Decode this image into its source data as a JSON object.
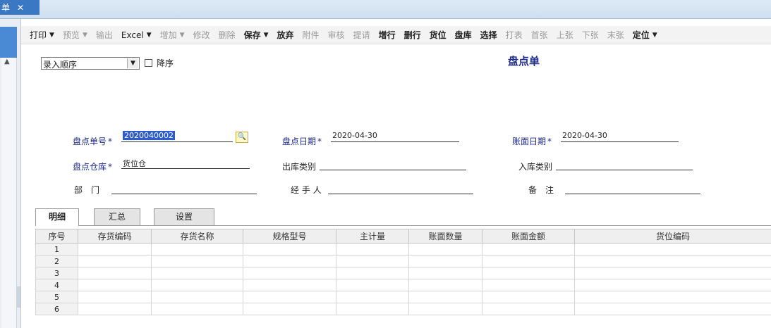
{
  "tab": {
    "title": "单",
    "close": "✕"
  },
  "toolbar": [
    {
      "label": "打印",
      "caret": true,
      "state": "normal"
    },
    {
      "label": "预览",
      "caret": true,
      "state": "disabled"
    },
    {
      "label": "输出",
      "caret": false,
      "state": "disabled"
    },
    {
      "label": "Excel",
      "caret": true,
      "state": "normal"
    },
    {
      "label": "增加",
      "caret": true,
      "state": "disabled"
    },
    {
      "label": "修改",
      "caret": false,
      "state": "disabled"
    },
    {
      "label": "删除",
      "caret": false,
      "state": "disabled"
    },
    {
      "label": "保存",
      "caret": true,
      "state": "bold"
    },
    {
      "label": "放弃",
      "caret": false,
      "state": "bold"
    },
    {
      "label": "附件",
      "caret": false,
      "state": "disabled"
    },
    {
      "label": "审核",
      "caret": false,
      "state": "disabled"
    },
    {
      "label": "提请",
      "caret": false,
      "state": "disabled"
    },
    {
      "label": "增行",
      "caret": false,
      "state": "bold"
    },
    {
      "label": "删行",
      "caret": false,
      "state": "bold"
    },
    {
      "label": "货位",
      "caret": false,
      "state": "bold"
    },
    {
      "label": "盘库",
      "caret": false,
      "state": "bold"
    },
    {
      "label": "选择",
      "caret": false,
      "state": "bold"
    },
    {
      "label": "打表",
      "caret": false,
      "state": "disabled"
    },
    {
      "label": "首张",
      "caret": false,
      "state": "disabled"
    },
    {
      "label": "上张",
      "caret": false,
      "state": "disabled"
    },
    {
      "label": "下张",
      "caret": false,
      "state": "disabled"
    },
    {
      "label": "末张",
      "caret": false,
      "state": "disabled"
    },
    {
      "label": "定位",
      "caret": true,
      "state": "bold"
    }
  ],
  "sort": {
    "selected": "录入顺序",
    "checkbox_label": "降序"
  },
  "form_title": "盘点单",
  "fields": {
    "count_no": {
      "label": "盘点单号",
      "value": "2020040002"
    },
    "count_date": {
      "label": "盘点日期",
      "value": "2020-04-30"
    },
    "book_date": {
      "label": "账面日期",
      "value": "2020-04-30"
    },
    "warehouse": {
      "label": "盘点仓库",
      "value": "货位仓"
    },
    "out_type": {
      "label": "出库类别",
      "value": ""
    },
    "in_type": {
      "label": "入库类别",
      "value": ""
    },
    "dept": {
      "label": "部　门",
      "value": ""
    },
    "handler": {
      "label": "经 手 人",
      "value": ""
    },
    "remark": {
      "label": "备　注",
      "value": ""
    }
  },
  "detail_tabs": [
    "明细",
    "汇总",
    "设置"
  ],
  "grid": {
    "columns": [
      "序号",
      "存货编码",
      "存货名称",
      "规格型号",
      "主计量",
      "账面数量",
      "账面金额",
      "货位编码"
    ],
    "rows": [
      "1",
      "2",
      "3",
      "4",
      "5",
      "6"
    ]
  },
  "colors": {
    "accent": "#1f2d8c",
    "tab_blue": "#3a78c4"
  }
}
